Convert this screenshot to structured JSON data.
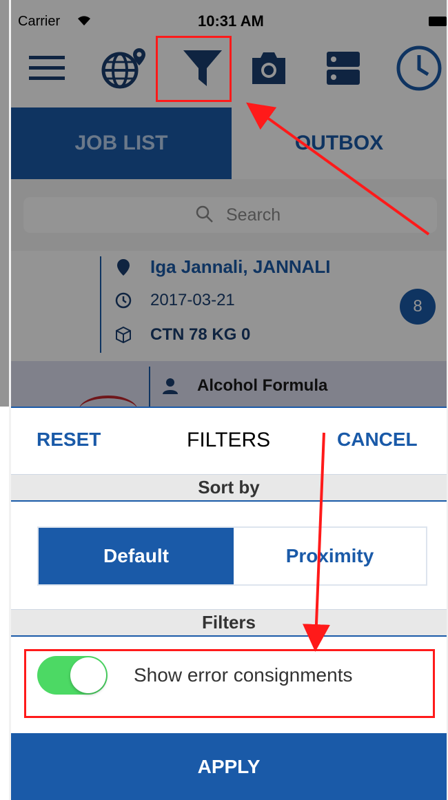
{
  "statusbar": {
    "carrier": "Carrier",
    "time": "10:31 AM"
  },
  "toolbar": {
    "icons": [
      "menu-icon",
      "globe-location-icon",
      "filter-icon",
      "camera-icon",
      "list-icon",
      "clock-icon"
    ]
  },
  "tabs": {
    "job_list": "JOB LIST",
    "outbox": "OUTBOX"
  },
  "search": {
    "placeholder": "Search"
  },
  "job": {
    "location": "Iga Jannali, JANNALI",
    "date": "2017-03-21",
    "cargo": "CTN 78 KG 0",
    "badge": "8"
  },
  "job2": {
    "name": "Alcohol Formula"
  },
  "filter_sheet": {
    "reset": "RESET",
    "title": "FILTERS",
    "cancel": "CANCEL",
    "sort_by": "Sort by",
    "sort_options": {
      "default": "Default",
      "proximity": "Proximity"
    },
    "filters_section": "Filters",
    "show_error_label": "Show error consignments",
    "apply": "APPLY"
  },
  "colors": {
    "primary": "#1a5aa8",
    "toggle_on": "#4cd964",
    "annotation": "#ff1a1a"
  }
}
